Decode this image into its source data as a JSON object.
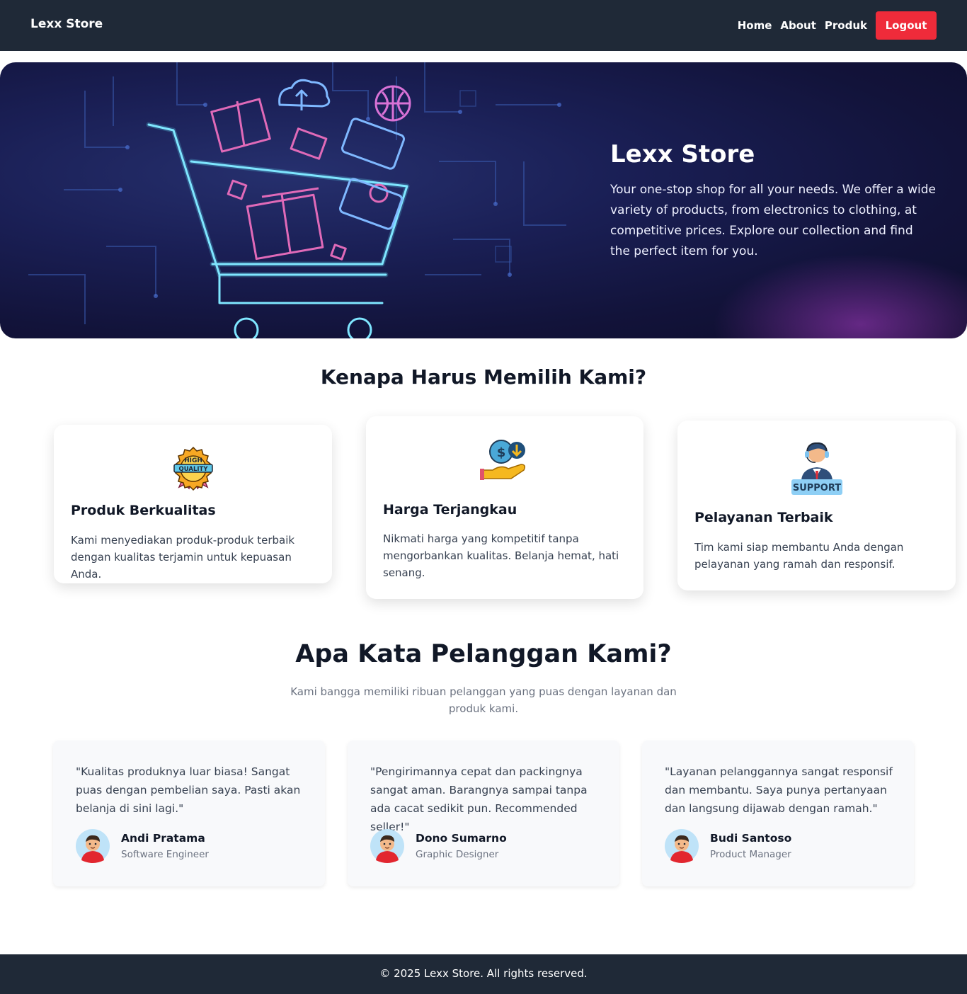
{
  "navbar": {
    "brand": "Lexx Store",
    "links": [
      "Home",
      "About",
      "Produk"
    ],
    "logout_label": "Logout"
  },
  "hero": {
    "title": "Lexx Store",
    "description": "Your one-stop shop for all your needs. We offer a wide variety of products, from electronics to clothing, at competitive prices. Explore our collection and find the perfect item for you."
  },
  "why": {
    "title": "Kenapa Harus Memilih Kami?",
    "features": [
      {
        "icon": "high-quality-badge-icon",
        "badge_text": [
          "HIGH",
          "QUALITY"
        ],
        "title": "Produk Berkualitas",
        "description": "Kami menyediakan produk-produk terbaik dengan kualitas terjamin untuk kepuasan Anda."
      },
      {
        "icon": "affordable-price-icon",
        "title": "Harga Terjangkau",
        "description": "Nikmati harga yang kompetitif tanpa mengorbankan kualitas. Belanja hemat, hati senang."
      },
      {
        "icon": "support-agent-icon",
        "badge_text": "SUPPORT",
        "title": "Pelayanan Terbaik",
        "description": "Tim kami siap membantu Anda dengan pelayanan yang ramah dan responsif."
      }
    ]
  },
  "testimonials": {
    "title": "Apa Kata Pelanggan Kami?",
    "subtitle": "Kami bangga memiliki ribuan pelanggan yang puas dengan layanan dan produk kami.",
    "items": [
      {
        "quote": "\"Kualitas produknya luar biasa! Sangat puas dengan pembelian saya. Pasti akan belanja di sini lagi.\"",
        "name": "Andi Pratama",
        "role": "Software Engineer"
      },
      {
        "quote": "\"Pengirimannya cepat dan packingnya sangat aman. Barangnya sampai tanpa ada cacat sedikit pun. Recommended seller!\"",
        "name": "Dono Sumarno",
        "role": "Graphic Designer"
      },
      {
        "quote": "\"Layanan pelanggannya sangat responsif dan membantu. Saya punya pertanyaan dan langsung dijawab dengan ramah.\"",
        "name": "Budi Santoso",
        "role": "Product Manager"
      }
    ]
  },
  "footer": {
    "text": "© 2025 Lexx Store. All rights reserved."
  },
  "colors": {
    "navbar_bg": "#1f2937",
    "logout_bg": "#ef2b3a",
    "hero_bg": "#1a1f55",
    "card_bg": "#f8f9fb"
  }
}
